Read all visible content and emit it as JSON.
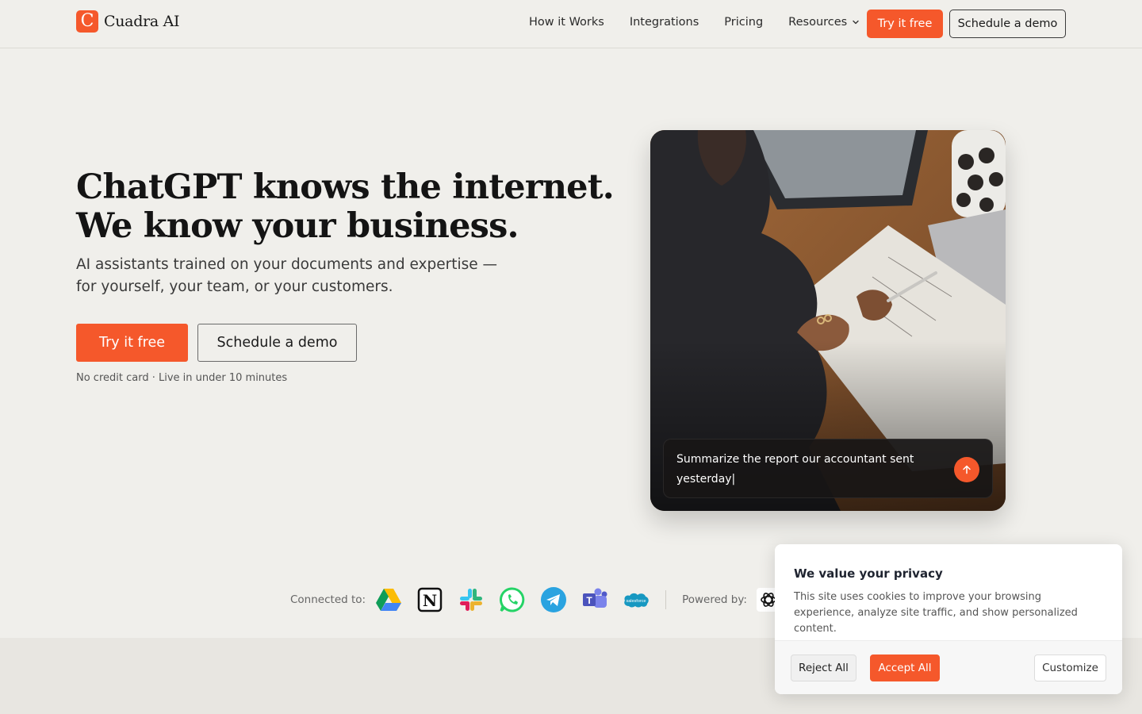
{
  "brand": {
    "name": "Cuadra AI",
    "mark": "C",
    "accent": "#f5582b"
  },
  "nav": {
    "items": [
      "How it Works",
      "Integrations",
      "Pricing",
      "Resources"
    ],
    "try_label": "Try it free",
    "demo_label": "Schedule a demo"
  },
  "hero": {
    "title_line1": "ChatGPT knows the internet.",
    "title_line2": "We know your business.",
    "subtitle": "AI assistants trained on your documents and expertise — for yourself, your team, or your customers.",
    "try_label": "Try it free",
    "demo_label": "Schedule a demo",
    "note": "No credit card · Live in under 10 minutes"
  },
  "card": {
    "prompt_text": "Summarize the report our accountant sent yesterday|"
  },
  "integrations": {
    "connected_label": "Connected to:",
    "icons": [
      "google-drive-icon",
      "notion-icon",
      "slack-icon",
      "whatsapp-icon",
      "telegram-icon",
      "microsoft-teams-icon",
      "salesforce-icon"
    ],
    "salesforce_text": "salesforce",
    "teams_letter": "T",
    "notion_letter": "N",
    "powered_label": "Powered by:",
    "powered_icon": "openai-icon"
  },
  "cookie": {
    "title": "We value your privacy",
    "text": "This site uses cookies to improve your browsing experience, analyze site traffic, and show personalized content.",
    "reject_label": "Reject All",
    "accept_label": "Accept All",
    "customize_label": "Customize"
  }
}
